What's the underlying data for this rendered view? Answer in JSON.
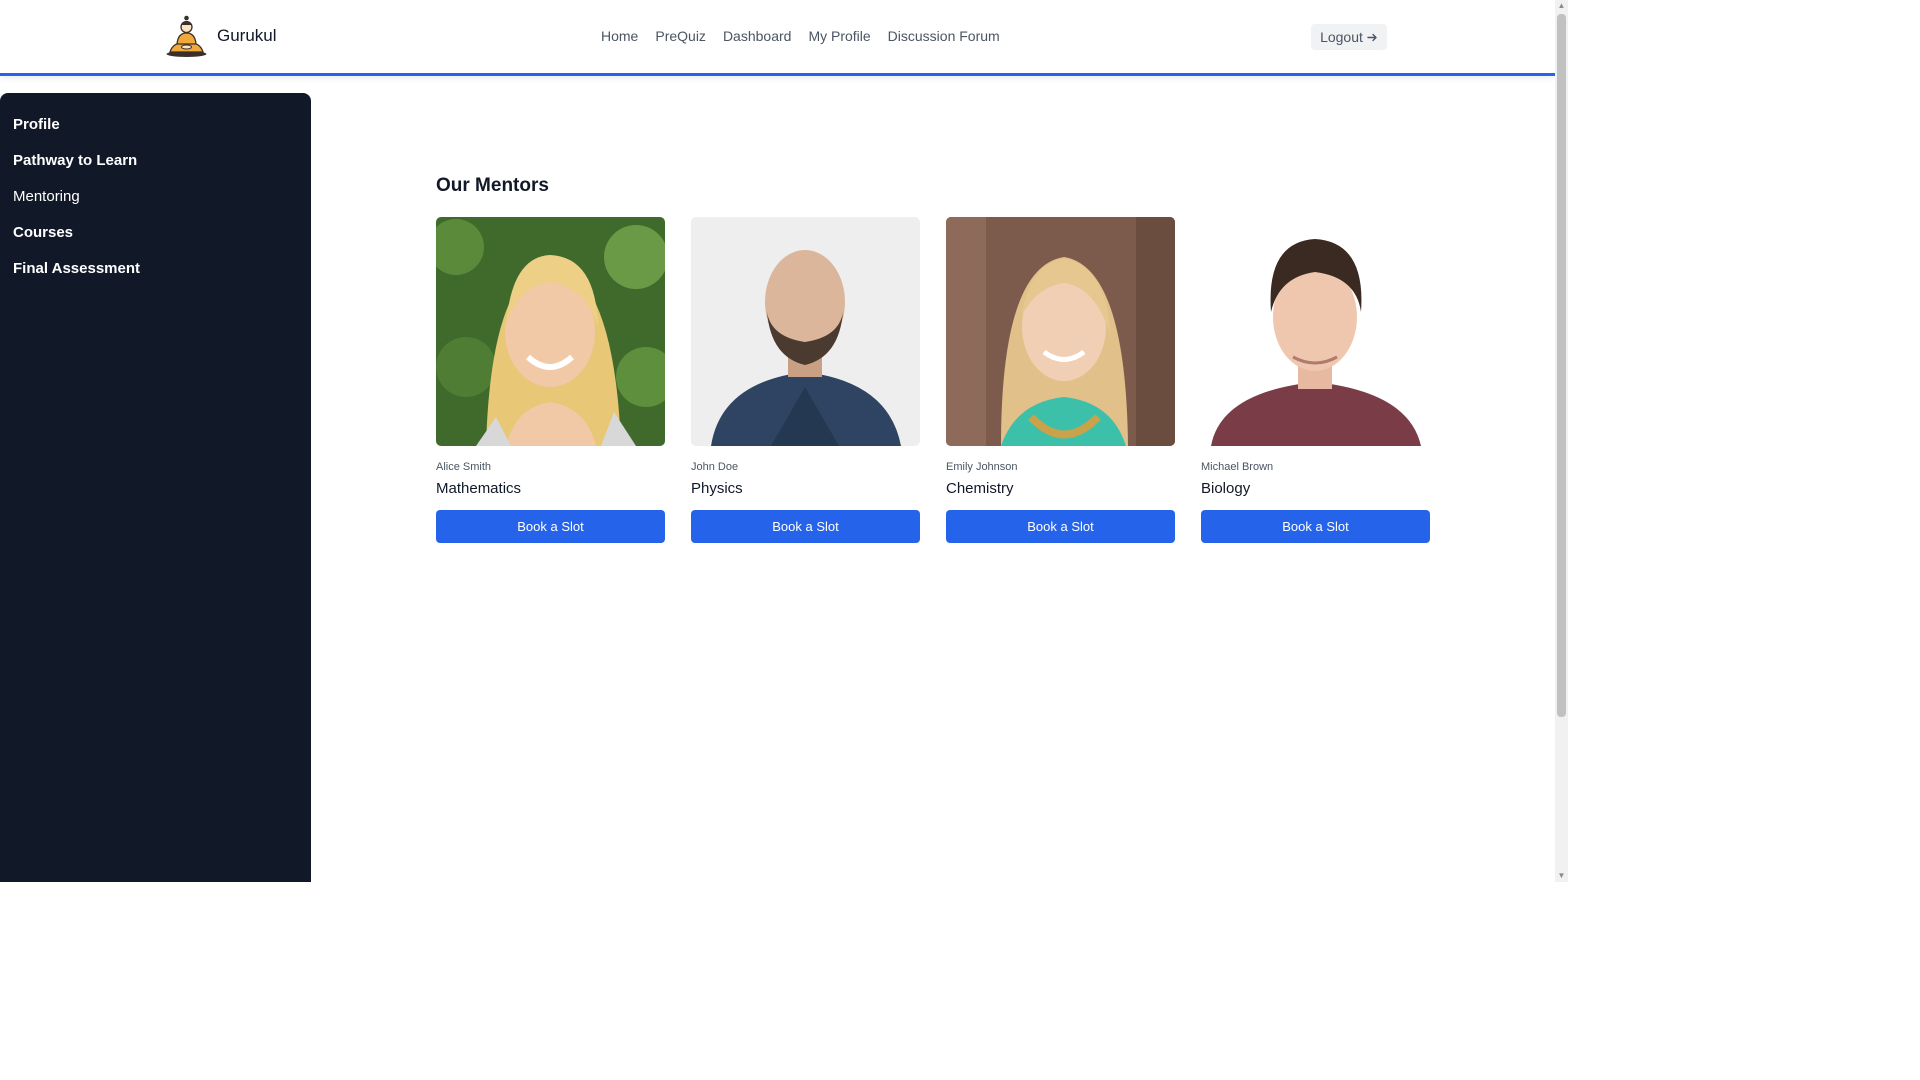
{
  "header": {
    "brand_name": "Gurukul",
    "nav": [
      "Home",
      "PreQuiz",
      "Dashboard",
      "My Profile",
      "Discussion Forum"
    ],
    "logout_label": "Logout",
    "logout_icon": "arrow-right-icon",
    "accent_color": "#2563eb"
  },
  "sidebar": {
    "items": [
      {
        "label": "Profile"
      },
      {
        "label": "Pathway to Learn"
      },
      {
        "label": "Mentoring"
      },
      {
        "label": "Courses"
      },
      {
        "label": "Final Assessment"
      }
    ],
    "background": "#111827"
  },
  "main": {
    "title": "Our Mentors",
    "mentors": [
      {
        "name": "Alice Smith",
        "subject": "Mathematics",
        "button": "Book a Slot"
      },
      {
        "name": "John Doe",
        "subject": "Physics",
        "button": "Book a Slot"
      },
      {
        "name": "Emily Johnson",
        "subject": "Chemistry",
        "button": "Book a Slot"
      },
      {
        "name": "Michael Brown",
        "subject": "Biology",
        "button": "Book a Slot"
      }
    ]
  }
}
